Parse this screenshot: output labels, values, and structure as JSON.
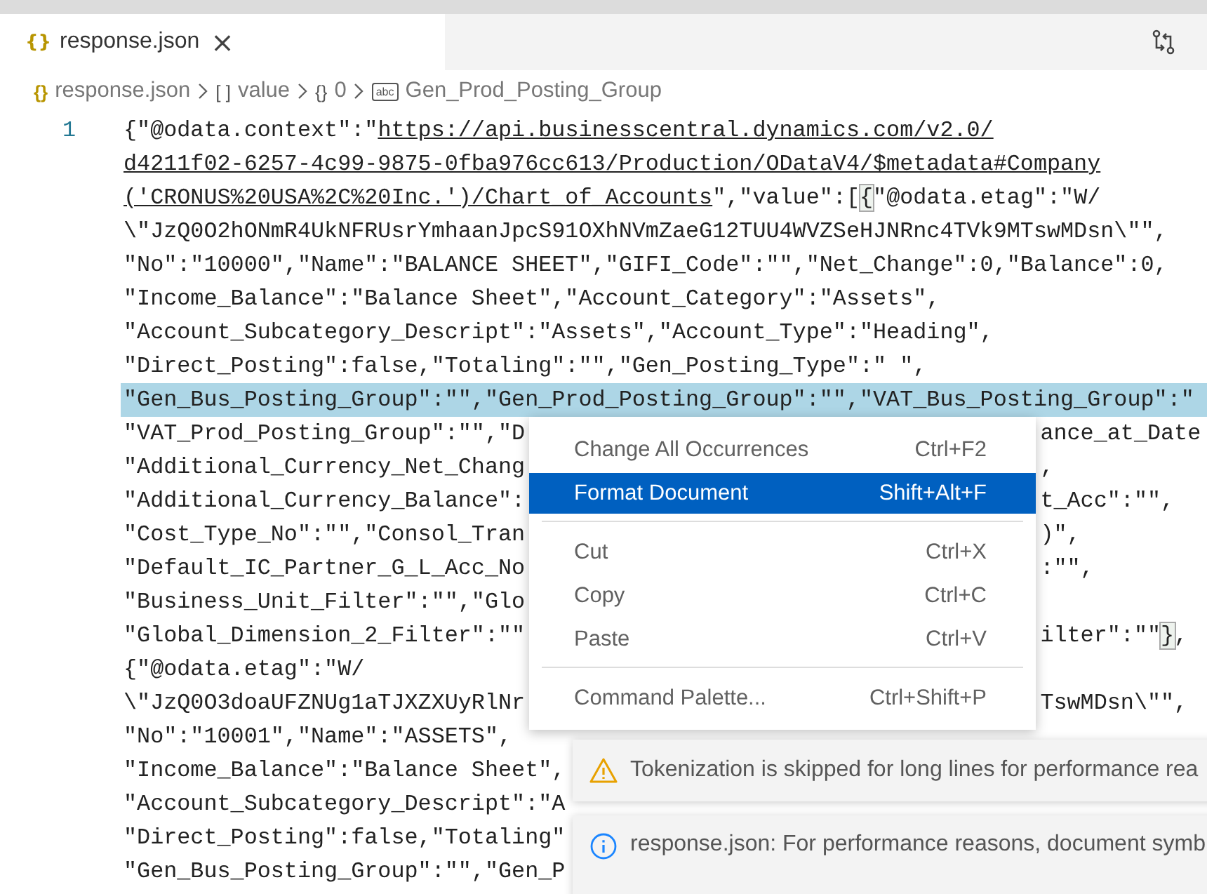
{
  "tab": {
    "icon": "{}",
    "label": "response.json",
    "close": "×",
    "selected": true
  },
  "breadcrumb": [
    {
      "icon": "{}",
      "kind": "file",
      "label": "response.json"
    },
    {
      "icon": "[ ]",
      "kind": "array",
      "label": "value"
    },
    {
      "icon": "{}",
      "kind": "object",
      "label": "0"
    },
    {
      "icon": "abc",
      "kind": "string",
      "label": "Gen_Prod_Posting_Group"
    }
  ],
  "editor": {
    "line_number": "1",
    "rows": [
      {
        "selected": false,
        "parts": [
          {
            "kind": "plain",
            "text": "{\"@odata.context\":\""
          },
          {
            "kind": "link",
            "text": "https://api.businesscentral.dynamics.com/v2.0/"
          }
        ]
      },
      {
        "selected": false,
        "parts": [
          {
            "kind": "link",
            "text": "d4211f02-6257-4c99-9875-0fba976cc613/Production/ODataV4/$metadata#Company"
          }
        ]
      },
      {
        "selected": false,
        "parts": [
          {
            "kind": "link",
            "text": "('CRONUS%20USA%2C%20Inc.')/Chart_of_Accounts"
          },
          {
            "kind": "plain",
            "text": "\",\"value\":["
          },
          {
            "kind": "bracket",
            "text": "{"
          },
          {
            "kind": "plain",
            "text": "\"@odata.etag\":\"W/"
          }
        ]
      },
      {
        "selected": false,
        "parts": [
          {
            "kind": "plain",
            "text": "\\\"JzQ0O2hONmR4UkNFRUsrYmhaanJpcS91OXhNVmZaeG12TUU4WVZSeHJNRnc4TVk9MTswMDsn\\\"\","
          }
        ]
      },
      {
        "selected": false,
        "parts": [
          {
            "kind": "plain",
            "text": "\"No\":\"10000\",\"Name\":\"BALANCE SHEET\",\"GIFI_Code\":\"\",\"Net_Change\":0,\"Balance\":0,"
          }
        ]
      },
      {
        "selected": false,
        "parts": [
          {
            "kind": "plain",
            "text": "\"Income_Balance\":\"Balance Sheet\",\"Account_Category\":\"Assets\","
          }
        ]
      },
      {
        "selected": false,
        "parts": [
          {
            "kind": "plain",
            "text": "\"Account_Subcategory_Descript\":\"Assets\",\"Account_Type\":\"Heading\","
          }
        ]
      },
      {
        "selected": false,
        "parts": [
          {
            "kind": "plain",
            "text": "\"Direct_Posting\":false,\"Totaling\":\"\",\"Gen_Posting_Type\":\" \","
          }
        ]
      },
      {
        "selected": true,
        "parts": [
          {
            "kind": "plain",
            "text": "\"Gen_Bus_Posting_Group\":\"\",\"Gen_Prod_Posting_Group\":\"\",\"VAT_Bus_Posting_Group\":\""
          }
        ]
      },
      {
        "selected": false,
        "parts": [
          {
            "kind": "plain",
            "text": "\"VAT_Prod_Posting_Group\":\"\",\"D"
          }
        ],
        "tail": [
          {
            "kind": "plain",
            "text": "ance_at_Date"
          }
        ]
      },
      {
        "selected": false,
        "parts": [
          {
            "kind": "plain",
            "text": "\"Additional_Currency_Net_Chang"
          }
        ],
        "tail": [
          {
            "kind": "plain",
            "text": ","
          }
        ]
      },
      {
        "selected": false,
        "parts": [
          {
            "kind": "plain",
            "text": "\"Additional_Currency_Balance\":"
          }
        ],
        "tail": [
          {
            "kind": "plain",
            "text": "t_Acc\":\"\","
          }
        ]
      },
      {
        "selected": false,
        "parts": [
          {
            "kind": "plain",
            "text": "\"Cost_Type_No\":\"\",\"Consol_Tran"
          }
        ],
        "tail": [
          {
            "kind": "plain",
            "text": ")\","
          }
        ]
      },
      {
        "selected": false,
        "parts": [
          {
            "kind": "plain",
            "text": "\"Default_IC_Partner_G_L_Acc_No"
          }
        ],
        "tail": [
          {
            "kind": "plain",
            "text": ":\"\","
          }
        ]
      },
      {
        "selected": false,
        "parts": [
          {
            "kind": "plain",
            "text": "\"Business_Unit_Filter\":\"\",\"Glo"
          }
        ]
      },
      {
        "selected": false,
        "parts": [
          {
            "kind": "plain",
            "text": "\"Global_Dimension_2_Filter\":\"\""
          }
        ],
        "tail": [
          {
            "kind": "plain",
            "text": "ilter\":\"\""
          },
          {
            "kind": "bracket",
            "text": "}"
          },
          {
            "kind": "plain",
            "text": ","
          }
        ]
      },
      {
        "selected": false,
        "parts": [
          {
            "kind": "plain",
            "text": "{\"@odata.etag\":\"W/"
          }
        ]
      },
      {
        "selected": false,
        "parts": [
          {
            "kind": "plain",
            "text": "\\\"JzQ0O3doaUFZNUg1aTJXZXUyRlNr"
          }
        ],
        "tail": [
          {
            "kind": "plain",
            "text": "TswMDsn\\\"\","
          }
        ]
      },
      {
        "selected": false,
        "parts": [
          {
            "kind": "plain",
            "text": "\"No\":\"10001\",\"Name\":\"ASSETS\","
          }
        ]
      },
      {
        "selected": false,
        "parts": [
          {
            "kind": "plain",
            "text": "\"Income_Balance\":\"Balance Sheet\","
          }
        ]
      },
      {
        "selected": false,
        "parts": [
          {
            "kind": "plain",
            "text": "\"Account_Subcategory_Descript\":\"A"
          }
        ]
      },
      {
        "selected": false,
        "parts": [
          {
            "kind": "plain",
            "text": "\"Direct_Posting\":false,\"Totaling\""
          }
        ]
      },
      {
        "selected": false,
        "parts": [
          {
            "kind": "plain",
            "text": "\"Gen_Bus_Posting_Group\":\"\",\"Gen_P"
          }
        ]
      }
    ]
  },
  "context_menu": [
    {
      "kind": "item",
      "label": "Change All Occurrences",
      "shortcut": "Ctrl+F2",
      "selected": false
    },
    {
      "kind": "item",
      "label": "Format Document",
      "shortcut": "Shift+Alt+F",
      "selected": true
    },
    {
      "kind": "separator"
    },
    {
      "kind": "item",
      "label": "Cut",
      "shortcut": "Ctrl+X",
      "selected": false
    },
    {
      "kind": "item",
      "label": "Copy",
      "shortcut": "Ctrl+C",
      "selected": false
    },
    {
      "kind": "item",
      "label": "Paste",
      "shortcut": "Ctrl+V",
      "selected": false
    },
    {
      "kind": "separator"
    },
    {
      "kind": "item",
      "label": "Command Palette...",
      "shortcut": "Ctrl+Shift+P",
      "selected": false
    }
  ],
  "notifications": [
    {
      "kind": "warning",
      "message": "Tokenization is skipped for long lines for performance rea"
    },
    {
      "kind": "info",
      "message": "response.json: For performance reasons, document symb"
    }
  ]
}
